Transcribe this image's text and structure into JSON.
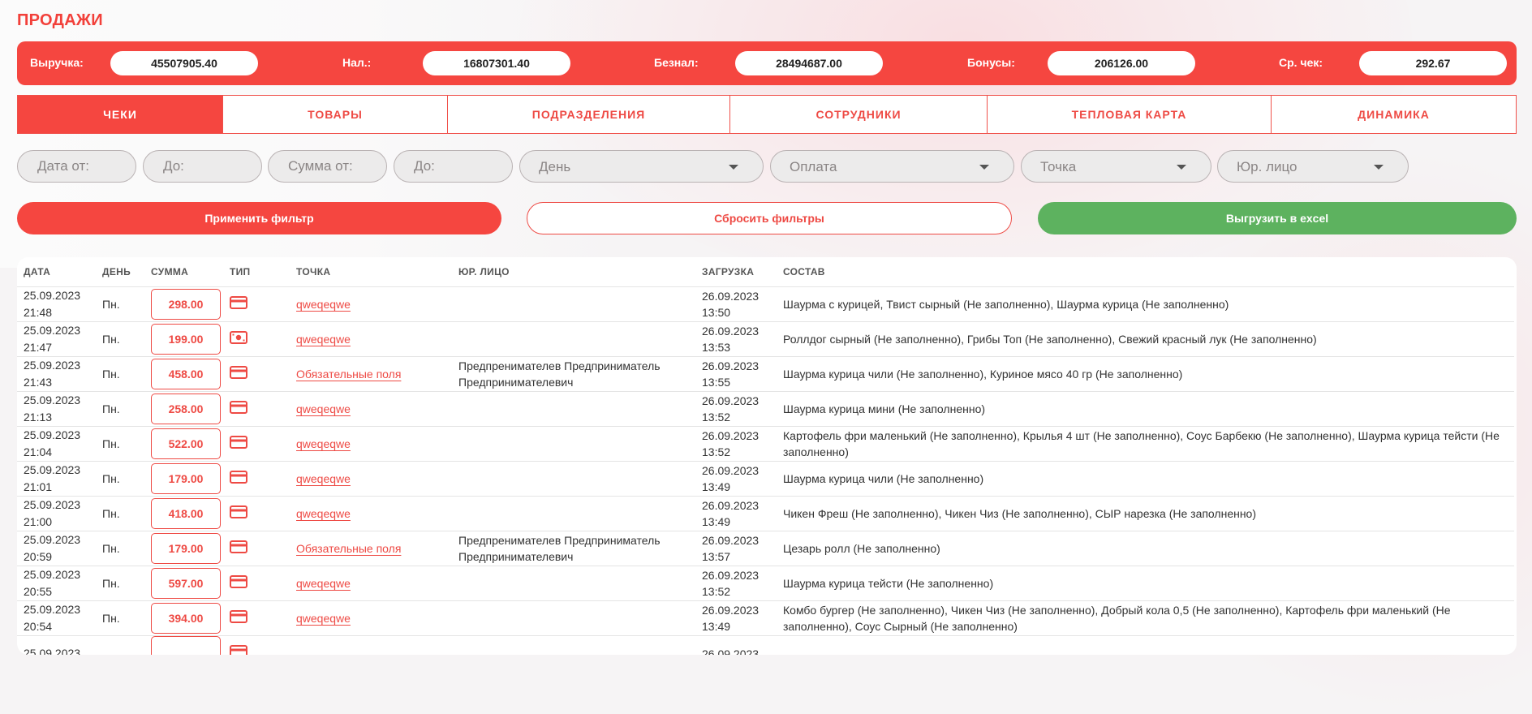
{
  "page": {
    "title": "ПРОДАЖИ"
  },
  "stats": [
    {
      "label": "Выручка:",
      "value": "45507905.40"
    },
    {
      "label": "Нал.:",
      "value": "16807301.40"
    },
    {
      "label": "Безнал:",
      "value": "28494687.00"
    },
    {
      "label": "Бонусы:",
      "value": "206126.00"
    },
    {
      "label": "Ср. чек:",
      "value": "292.67"
    }
  ],
  "tabs": [
    {
      "label": "ЧЕКИ",
      "active": true
    },
    {
      "label": "ТОВАРЫ"
    },
    {
      "label": "ПОДРАЗДЕЛЕНИЯ"
    },
    {
      "label": "СОТРУДНИКИ"
    },
    {
      "label": "ТЕПЛОВАЯ КАРТА"
    },
    {
      "label": "ДИНАМИКА"
    }
  ],
  "filters": {
    "date_from": "Дата от:",
    "date_to": "До:",
    "sum_from": "Сумма от:",
    "sum_to": "До:",
    "day": "День",
    "payment": "Оплата",
    "point": "Точка",
    "legal": "Юр. лицо"
  },
  "buttons": {
    "apply": "Применить фильтр",
    "reset": "Сбросить фильтры",
    "excel": "Выгрузить в excel"
  },
  "colors": {
    "accent": "#f54640",
    "success": "#5db25f"
  },
  "table": {
    "headers": {
      "date": "ДАТА",
      "day": "ДЕНЬ",
      "sum": "СУММА",
      "type": "ТИП",
      "point": "ТОЧКА",
      "legal": "ЮР. ЛИЦО",
      "upload": "ЗАГРУЗКА",
      "items": "СОСТАВ"
    },
    "rows": [
      {
        "date": "25.09.2023",
        "time": "21:48",
        "day": "Пн.",
        "sum": "298.00",
        "type": "card-icon",
        "point": "qweqeqwe",
        "legal": "",
        "up_date": "26.09.2023",
        "up_time": "13:50",
        "items": "Шаурма с курицей, Твист сырный (Не заполненно), Шаурма курица (Не заполненно)"
      },
      {
        "date": "25.09.2023",
        "time": "21:47",
        "day": "Пн.",
        "sum": "199.00",
        "type": "cash-icon",
        "point": "qweqeqwe",
        "legal": "",
        "up_date": "26.09.2023",
        "up_time": "13:53",
        "items": "Роллдог сырный (Не заполненно), Грибы Топ (Не заполненно), Свежий красный лук (Не заполненно)"
      },
      {
        "date": "25.09.2023",
        "time": "21:43",
        "day": "Пн.",
        "sum": "458.00",
        "type": "card-icon",
        "point": "Обязательные поля",
        "legal": "Предпренимателев Предприниматель Предпринимателевич",
        "up_date": "26.09.2023",
        "up_time": "13:55",
        "items": "Шаурма курица чили (Не заполненно), Куриное мясо 40 гр (Не заполненно)"
      },
      {
        "date": "25.09.2023",
        "time": "21:13",
        "day": "Пн.",
        "sum": "258.00",
        "type": "card-icon",
        "point": "qweqeqwe",
        "legal": "",
        "up_date": "26.09.2023",
        "up_time": "13:52",
        "items": "Шаурма курица мини (Не заполненно)"
      },
      {
        "date": "25.09.2023",
        "time": "21:04",
        "day": "Пн.",
        "sum": "522.00",
        "type": "card-icon",
        "point": "qweqeqwe",
        "legal": "",
        "up_date": "26.09.2023",
        "up_time": "13:52",
        "items": "Картофель фри маленький (Не заполненно), Крылья 4 шт (Не заполненно), Соус Барбекю (Не заполненно), Шаурма курица тейсти (Не заполненно)"
      },
      {
        "date": "25.09.2023",
        "time": "21:01",
        "day": "Пн.",
        "sum": "179.00",
        "type": "card-icon",
        "point": "qweqeqwe",
        "legal": "",
        "up_date": "26.09.2023",
        "up_time": "13:49",
        "items": "Шаурма курица чили (Не заполненно)"
      },
      {
        "date": "25.09.2023",
        "time": "21:00",
        "day": "Пн.",
        "sum": "418.00",
        "type": "card-icon",
        "point": "qweqeqwe",
        "legal": "",
        "up_date": "26.09.2023",
        "up_time": "13:49",
        "items": "Чикен Фреш (Не заполненно), Чикен Чиз (Не заполненно), СЫР нарезка (Не заполненно)"
      },
      {
        "date": "25.09.2023",
        "time": "20:59",
        "day": "Пн.",
        "sum": "179.00",
        "type": "card-icon",
        "point": "Обязательные поля",
        "legal": "Предпренимателев Предприниматель Предпринимателевич",
        "up_date": "26.09.2023",
        "up_time": "13:57",
        "items": "Цезарь ролл (Не заполненно)"
      },
      {
        "date": "25.09.2023",
        "time": "20:55",
        "day": "Пн.",
        "sum": "597.00",
        "type": "card-icon",
        "point": "qweqeqwe",
        "legal": "",
        "up_date": "26.09.2023",
        "up_time": "13:52",
        "items": "Шаурма курица тейсти (Не заполненно)"
      },
      {
        "date": "25.09.2023",
        "time": "20:54",
        "day": "Пн.",
        "sum": "394.00",
        "type": "card-icon",
        "point": "qweqeqwe",
        "legal": "",
        "up_date": "26.09.2023",
        "up_time": "13:49",
        "items": "Комбо бургер (Не заполненно), Чикен Чиз (Не заполненно), Добрый кола 0,5 (Не заполненно), Картофель фри маленький (Не заполненно), Соус Сырный (Не заполненно)"
      },
      {
        "date": "25.09.2023",
        "time": "",
        "day": "",
        "sum": "",
        "type": "card-icon",
        "point": "",
        "legal": "",
        "up_date": "26.09.2023",
        "up_time": "",
        "items": ""
      }
    ]
  }
}
